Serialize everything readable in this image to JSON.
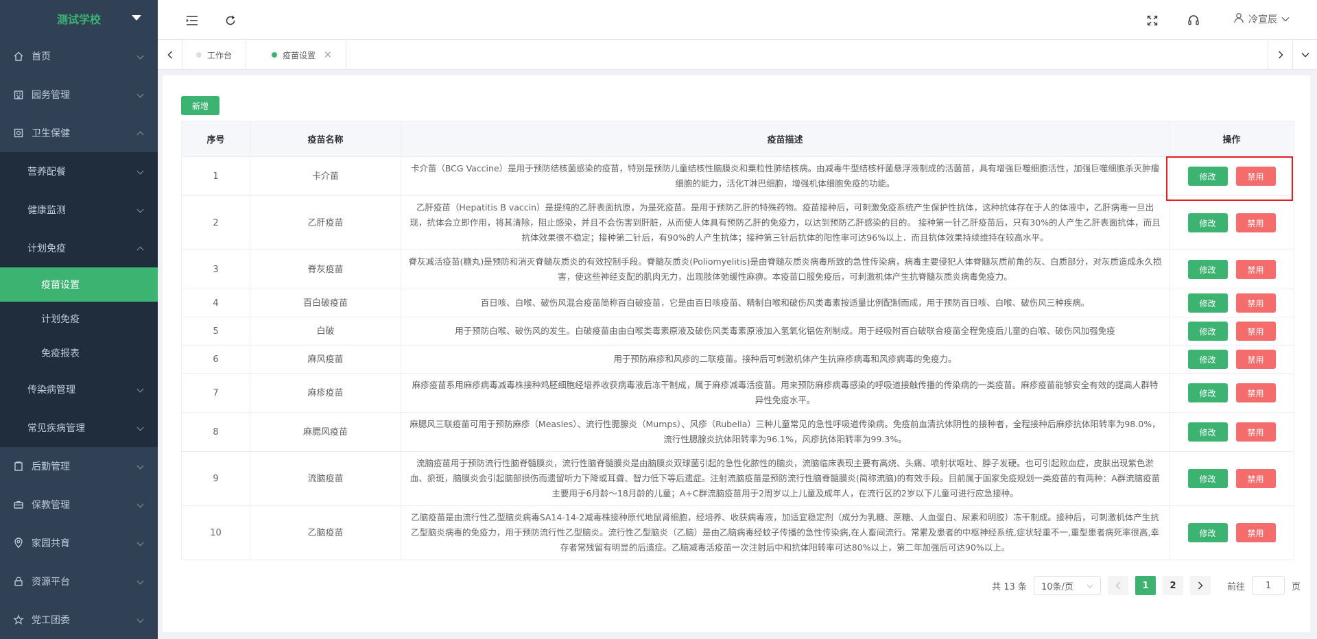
{
  "brand": {
    "title": "测试学校"
  },
  "sidebar": {
    "items": [
      {
        "label": "首页",
        "icon": "home-icon"
      },
      {
        "label": "园务管理",
        "icon": "building-icon"
      },
      {
        "label": "卫生保健",
        "icon": "health-icon"
      }
    ],
    "health_sub": [
      {
        "label": "营养配餐"
      },
      {
        "label": "健康监测"
      },
      {
        "label": "计划免疫"
      }
    ],
    "immune_sub": [
      {
        "label": "疫苗设置"
      },
      {
        "label": "计划免疫"
      },
      {
        "label": "免疫报表"
      }
    ],
    "health_sub_tail": [
      {
        "label": "传染病管理"
      },
      {
        "label": "常见疾病管理"
      }
    ],
    "bottom": [
      {
        "label": "后勤管理"
      },
      {
        "label": "保教管理"
      },
      {
        "label": "家园共育"
      },
      {
        "label": "资源平台"
      },
      {
        "label": "党工团委"
      }
    ]
  },
  "header": {
    "user_name": "冷宣辰"
  },
  "tabs": [
    {
      "label": "工作台"
    },
    {
      "label": "疫苗设置"
    }
  ],
  "toolbar": {
    "add_label": "新增"
  },
  "table": {
    "headers": [
      "序号",
      "疫苗名称",
      "疫苗描述",
      "操作"
    ],
    "edit_label": "修改",
    "disable_label": "禁用",
    "rows": [
      {
        "no": "1",
        "name": "卡介苗",
        "desc": "卡介苗（BCG Vaccine）是用于预防结核菌感染的疫苗，特别是预防儿童结核性脑膜炎和粟粒性肺结核病。由减毒牛型结核杆菌悬浮液制成的活菌苗，具有增强巨噬细胞活性，加强巨噬细胞杀灭肿瘤细胞的能力，活化T淋巴细胞，增强机体细胞免疫的功能。"
      },
      {
        "no": "2",
        "name": "乙肝疫苗",
        "desc": "乙肝疫苗（Hepatitis B vaccin）是提纯的乙肝表面抗原，为是死疫苗。是用于预防乙肝的特殊药物。疫苗接种后，可刺激免疫系统产生保护性抗体，这种抗体存在于人的体液中，乙肝病毒一旦出现，抗体会立即作用，将其清除，阻止感染，并且不会伤害到肝脏，从而使人体具有预防乙肝的免疫力，以达到预防乙肝感染的目的。 接种第一针乙肝疫苗后，只有30%的人产生乙肝表面抗体，而且抗体效果很不稳定；接种第二针后，有90%的人产生抗体；接种第三针后抗体的阳性率可达96%以上．而且抗体效果持续维持在较高水平。"
      },
      {
        "no": "3",
        "name": "脊灰疫苗",
        "desc": "脊灰减活疫苗(糖丸)是预防和消灭脊髓灰质炎的有效控制手段。脊髓灰质炎(Poliomyelitis)是由脊髓灰质炎病毒所致的急性传染病，病毒主要侵犯人体脊髓灰质前角的灰、白质部分，对灰质造成永久损害，使这些神经支配的肌肉无力，出现肢体弛缓性麻痹。本疫苗口服免疫后，可刺激机体产生抗脊髓灰质炎病毒免疫力。"
      },
      {
        "no": "4",
        "name": "百白破疫苗",
        "desc": "百日咳、白喉、破伤风混合疫苗简称百白破疫苗，它是由百日咳疫苗、精制白喉和破伤风类毒素按适量比例配制而成，用于预防百日咳、白喉、破伤风三种疾病。"
      },
      {
        "no": "5",
        "name": "白破",
        "desc": "用于预防白喉、破伤风的发生。白破疫苗由由白喉类毒素原液及破伤风类毒素原液加入氢氧化铝佐剂制成。用于经吸附百白破联合疫苗全程免疫后儿童的白喉、破伤风加强免疫"
      },
      {
        "no": "6",
        "name": "麻风疫苗",
        "desc": "用于预防麻疹和风疹的二联疫苗。接种后可刺激机体产生抗麻疹病毒和风疹病毒的免疫力。"
      },
      {
        "no": "7",
        "name": "麻疹疫苗",
        "desc": "麻疹疫苗系用麻疹病毒减毒株接种鸡胚细胞经培养收获病毒液后冻干制成，属于麻疹减毒活疫苗。用来预防麻疹病毒感染的呼吸道接触传播的传染病的一类疫苗。麻疹疫苗能够安全有效的提高人群特异性免疫水平。"
      },
      {
        "no": "8",
        "name": "麻腮风疫苗",
        "desc": "麻腮风三联疫苗可用于预防麻疹（Measles）、流行性腮腺炎（Mumps）、风疹（Rubella）三种儿童常见的急性呼吸道传染病。免疫前血清抗体阴性的接种者，全程接种后麻疹抗体阳转率为98.0%，流行性腮腺炎抗体阳转率为96.1%，风疹抗体阳转率为99.3%。"
      },
      {
        "no": "9",
        "name": "流脑疫苗",
        "desc": "流脑疫苗用于预防流行性脑脊髓膜炎，流行性脑脊髓膜炎是由脑膜炎双球菌引起的急性化脓性的脑炎，流脑临床表现主要有高烧、头痛、喷射状呕吐、脖子发硬。也可引起败血症，皮肤出现紫色淤血、瘀斑，脑膜炎会引起脑部损伤而遗留听力下降或耳聋、智力低下等后遗症。注射流脑疫苗是预防流行性脑脊髓膜炎(简称流脑)的有效手段。目前属于国家免疫规划一类疫苗的有两种：A群流脑疫苗主要用于6月龄～18月龄的儿童；A+C群流脑疫苗用于2周岁以上儿童及成年人，在流行区的2岁以下儿童可进行应急接种。"
      },
      {
        "no": "10",
        "name": "乙脑疫苗",
        "desc": "乙脑疫苗是由流行性乙型脑炎病毒SA14-14-2减毒株接种原代地鼠肾细胞，经培养、收获病毒液，加适宜稳定剂（成分为乳糖、蔗糖、人血蛋白、尿素和明胶）冻干制成。接种后，可刺激机体产生抗乙型脑炎病毒的免疫力，用于预防流行性乙型脑炎。流行性乙型脑炎（乙脑）是由乙脑病毒经蚊子传播的急性传染病,在人畜间流行。常累及患者的中枢神经系统,症状轻重不一,重型患者病死率很高,幸存者常残留有明显的后遗症。乙脑减毒活疫苗一次注射后中和抗体阳转率可达80%以上，第二年加强后可达90%以上。"
      }
    ]
  },
  "pagination": {
    "total_text": "共 13 条",
    "page_size": "10条/页",
    "pages": [
      "1",
      "2"
    ],
    "goto_prefix": "前往",
    "goto_value": "1",
    "goto_suffix": "页"
  },
  "colors": {
    "primary": "#3cb371",
    "danger": "#f56c6c",
    "sidebar": "#304156"
  }
}
